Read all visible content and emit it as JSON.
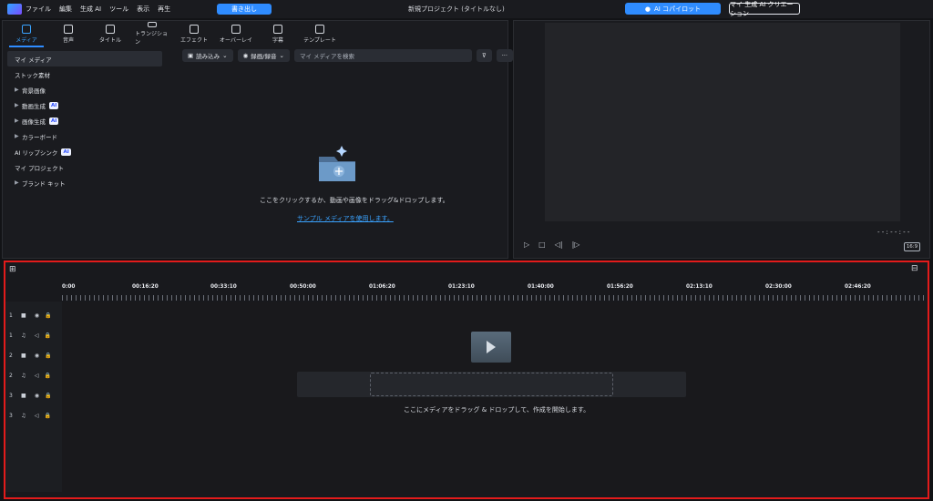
{
  "title_bar": {
    "menu": [
      "ファイル",
      "編集",
      "生成 AI",
      "ツール",
      "表示",
      "再生"
    ],
    "export_label": "書き出し",
    "project_title": "新規プロジェクト (タイトルなし)",
    "copilot_label": "AI コパイロット",
    "creation_label": "マイ 生成 AI クリエーション"
  },
  "media_tabs": [
    {
      "label": "メディア",
      "icon": "media-icon"
    },
    {
      "label": "音声",
      "icon": "music-icon"
    },
    {
      "label": "タイトル",
      "icon": "text-icon"
    },
    {
      "label": "トランジション",
      "icon": "transition-icon"
    },
    {
      "label": "エフェクト",
      "icon": "effect-icon"
    },
    {
      "label": "オーバーレイ",
      "icon": "overlay-icon"
    },
    {
      "label": "字幕",
      "icon": "subtitle-icon"
    },
    {
      "label": "テンプレート",
      "icon": "template-icon"
    }
  ],
  "sidebar": {
    "items": [
      {
        "label": "マイ メディア",
        "active": true,
        "arrow": false,
        "ai": false
      },
      {
        "label": "ストック素材",
        "active": false,
        "arrow": false,
        "ai": false
      },
      {
        "label": "背景画像",
        "active": false,
        "arrow": true,
        "ai": false
      },
      {
        "label": "動画生成",
        "active": false,
        "arrow": true,
        "ai": true
      },
      {
        "label": "画像生成",
        "active": false,
        "arrow": true,
        "ai": true
      },
      {
        "label": "カラーボード",
        "active": false,
        "arrow": true,
        "ai": false
      },
      {
        "label": "AI リップシンク",
        "active": false,
        "arrow": false,
        "ai": true
      },
      {
        "label": "マイ プロジェクト",
        "active": false,
        "arrow": false,
        "ai": false
      },
      {
        "label": "ブランド キット",
        "active": false,
        "arrow": true,
        "ai": false
      }
    ],
    "ai_badge": "AI"
  },
  "media_toolbar": {
    "import_label": "読み込み",
    "record_label": "録画/録音",
    "search_placeholder": "マイ メディアを検索"
  },
  "media_empty": {
    "text": "ここをクリックするか、動画や画像をドラッグ&ドロップします。",
    "sample_link": "サンプル メディアを使用します。"
  },
  "preview": {
    "time": "- - : - - : - -",
    "ratio": "16:9"
  },
  "timeline": {
    "ruler": [
      "0:00",
      "00:16:20",
      "00:33:10",
      "00:50:00",
      "01:06:20",
      "01:23:10",
      "01:40:00",
      "01:56:20",
      "02:13:10",
      "02:30:00",
      "02:46:20"
    ],
    "tracks": [
      {
        "num": "1",
        "type": "video"
      },
      {
        "num": "1",
        "type": "audio"
      },
      {
        "num": "2",
        "type": "video"
      },
      {
        "num": "2",
        "type": "audio"
      },
      {
        "num": "3",
        "type": "video"
      },
      {
        "num": "3",
        "type": "audio"
      }
    ],
    "drop_text": "ここにメディアをドラッグ & ドロップして、作成を開始します。"
  }
}
